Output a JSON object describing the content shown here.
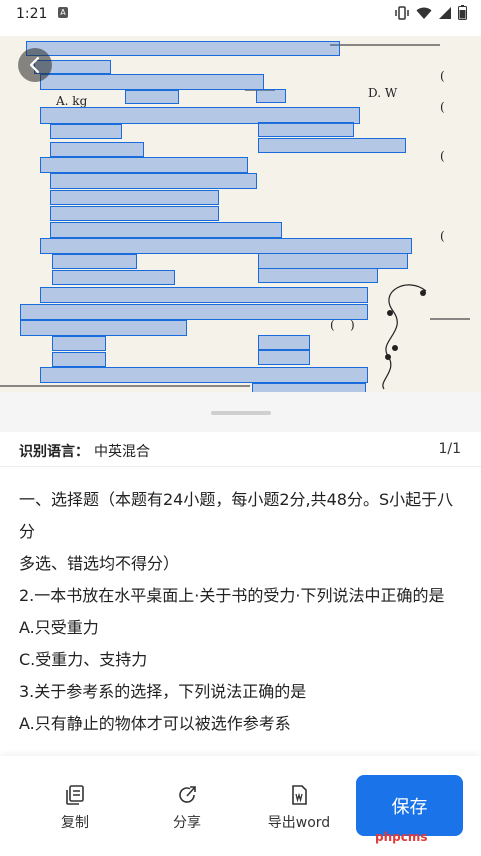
{
  "status_bar": {
    "time": "1:21"
  },
  "ocr_lines": [
    "一、选择题（本题有24小题，每小题2分,共48分。S小起于八分",
    "多选、错选均不得分）",
    "2.一本书放在水平桌面上·关于书的受力·下列说法中正确的是",
    "A.只受重力",
    "C.受重力、支持力",
    "3.关于参考系的选择，下列说法正确的是",
    "A.只有静止的物体才可以被选作参考系"
  ],
  "lang_row": {
    "label": "识别语言：",
    "value": "中英混合",
    "page": "1/1"
  },
  "toolbar": {
    "copy": "复制",
    "share": "分享",
    "export": "导出word",
    "save": "保存"
  },
  "watermark": "phpcms",
  "colors": {
    "accent": "#1a73e8",
    "highlight": "#1a6cdc"
  }
}
